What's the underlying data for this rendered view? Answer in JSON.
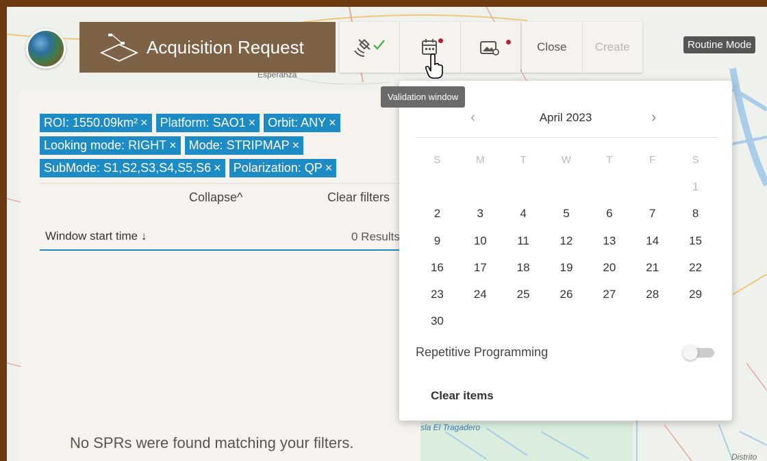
{
  "map": {
    "labels": {
      "esperanza": "Esperanza",
      "tragadero": "sla El Tragadero",
      "distrito": "Distrito"
    }
  },
  "toolbar": {
    "title": "Acquisition Request",
    "close_label": "Close",
    "create_label": "Create",
    "mode_label": "Routine Mode",
    "tooltip": "Validation window",
    "icons": [
      "satellite-check-icon",
      "calendar-icon",
      "image-settings-icon"
    ]
  },
  "filters": {
    "chips": [
      [
        "ROI: 1550.09km²",
        "Platform: SAO1",
        "Orbit: ANY"
      ],
      [
        "Looking mode: RIGHT",
        "Mode: STRIPMAP"
      ],
      [
        "SubMode: S1,S2,S3,S4,S5,S6",
        "Polarization: QP"
      ]
    ],
    "chip_close": "×",
    "collapse_label": "Collapse",
    "collapse_icon": "^",
    "clear_filters_label": "Clear filters"
  },
  "results": {
    "sort_label": "Window start time",
    "sort_icon": "↓",
    "count_label": "0 Results",
    "empty_message": "No SPRs were found matching your filters."
  },
  "calendar": {
    "month": "April",
    "year": "2023",
    "prev_icon": "‹",
    "next_icon": "›",
    "weekdays": [
      "S",
      "M",
      "T",
      "W",
      "T",
      "F",
      "S"
    ],
    "weeks": [
      [
        "",
        "",
        "",
        "",
        "",
        "",
        "1"
      ],
      [
        "2",
        "3",
        "4",
        "5",
        "6",
        "7",
        "8"
      ],
      [
        "9",
        "10",
        "11",
        "12",
        "13",
        "14",
        "15"
      ],
      [
        "16",
        "17",
        "18",
        "19",
        "20",
        "21",
        "22"
      ],
      [
        "23",
        "24",
        "25",
        "26",
        "27",
        "28",
        "29"
      ],
      [
        "30",
        "",
        "",
        "",
        "",
        "",
        ""
      ]
    ],
    "repetitive_label": "Repetitive Programming",
    "repetitive_on": false,
    "clear_items_label": "Clear items"
  },
  "colors": {
    "title_bg": "#7e6245",
    "chip_bg": "#1d8bc4",
    "frame": "#6b3a12",
    "alert_dot": "#b4242a"
  }
}
